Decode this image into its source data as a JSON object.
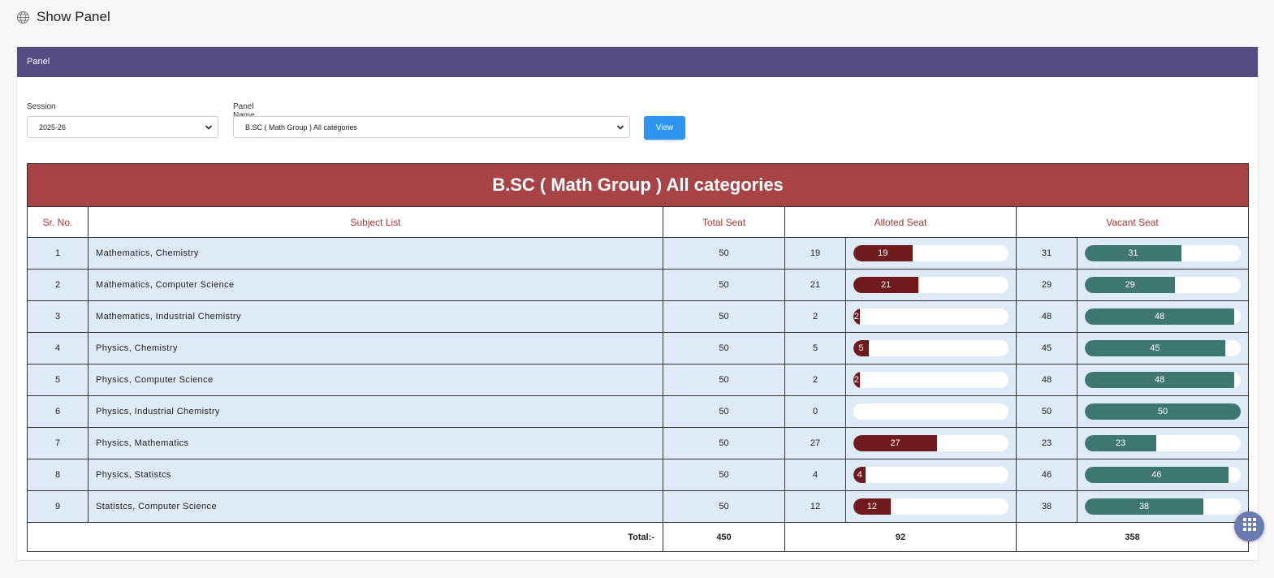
{
  "page": {
    "title": "Show Panel",
    "icon": "globe-icon"
  },
  "panel": {
    "header": "Panel",
    "session": {
      "label": "Session",
      "value": "2025-26"
    },
    "panel_name": {
      "label": "Panel Name",
      "value": "B.SC ( Math Group ) All categories"
    },
    "view_label": "View"
  },
  "table": {
    "caption": "B.SC ( Math Group ) All categories",
    "headers": {
      "sr": "Sr. No.",
      "subject": "Subject List",
      "total": "Total Seat",
      "alloted": "Alloted Seat",
      "vacant": "Vacant Seat"
    },
    "rows": [
      {
        "sr": "1",
        "subject": "Mathematics, Chemistry",
        "total": "50",
        "alloted": "19",
        "alloted_bar": "19",
        "vacant": "31",
        "vacant_bar": "31"
      },
      {
        "sr": "2",
        "subject": "Mathematics, Computer Science",
        "total": "50",
        "alloted": "21",
        "alloted_bar": "21",
        "vacant": "29",
        "vacant_bar": "29"
      },
      {
        "sr": "3",
        "subject": "Mathematics, Industrial Chemistry",
        "total": "50",
        "alloted": "2",
        "alloted_bar": "2",
        "vacant": "48",
        "vacant_bar": "48"
      },
      {
        "sr": "4",
        "subject": "Physics, Chemistry",
        "total": "50",
        "alloted": "5",
        "alloted_bar": "5",
        "vacant": "45",
        "vacant_bar": "45"
      },
      {
        "sr": "5",
        "subject": "Physics, Computer Science",
        "total": "50",
        "alloted": "2",
        "alloted_bar": "2",
        "vacant": "48",
        "vacant_bar": "48"
      },
      {
        "sr": "6",
        "subject": "Physics, Industrial Chemistry",
        "total": "50",
        "alloted": "0",
        "alloted_bar": "",
        "vacant": "50",
        "vacant_bar": "50"
      },
      {
        "sr": "7",
        "subject": "Physics, Mathematics",
        "total": "50",
        "alloted": "27",
        "alloted_bar": "27",
        "vacant": "23",
        "vacant_bar": "23"
      },
      {
        "sr": "8",
        "subject": "Physics, Statistcs",
        "total": "50",
        "alloted": "4",
        "alloted_bar": "4",
        "vacant": "46",
        "vacant_bar": "46"
      },
      {
        "sr": "9",
        "subject": "Statistcs, Computer Science",
        "total": "50",
        "alloted": "12",
        "alloted_bar": "12",
        "vacant": "38",
        "vacant_bar": "38"
      }
    ],
    "totals": {
      "label": "Total:-",
      "total": "450",
      "alloted": "92",
      "vacant": "358"
    }
  },
  "colors": {
    "header": "#564c81",
    "caption": "#a84445",
    "alloted_bar": "#711a1c",
    "vacant_bar": "#3d7770",
    "row_bg": "#deeaf6",
    "button": "#2e95ee"
  },
  "fab": {
    "icon": "grid-menu-icon"
  }
}
